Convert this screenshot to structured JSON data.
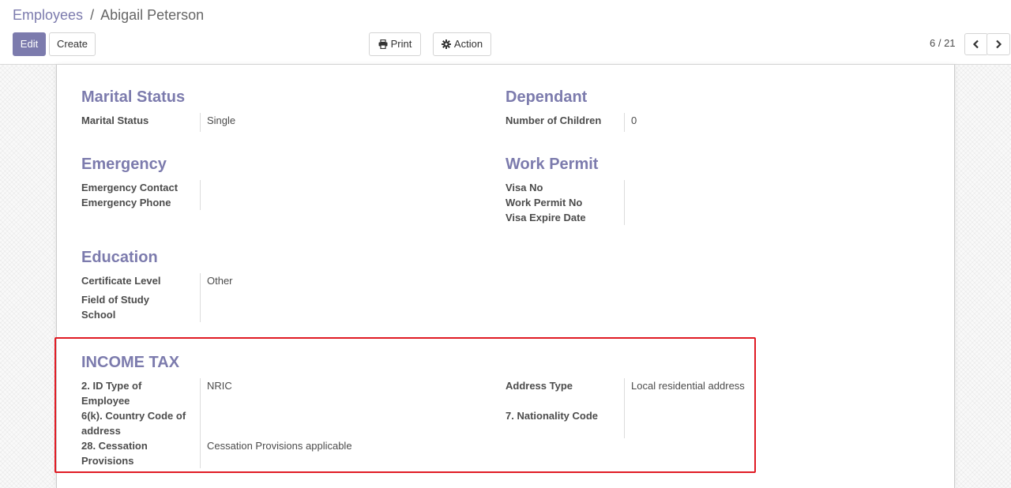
{
  "breadcrumb": {
    "parent": "Employees",
    "separator": "/",
    "current": "Abigail Peterson"
  },
  "toolbar": {
    "edit_label": "Edit",
    "create_label": "Create",
    "print_label": "Print",
    "action_label": "Action"
  },
  "pager": {
    "value": "6 / 21"
  },
  "sections": {
    "marital": {
      "title": "Marital Status",
      "fields": [
        {
          "label": "Marital Status",
          "value": "Single"
        }
      ]
    },
    "dependant": {
      "title": "Dependant",
      "fields": [
        {
          "label": "Number of Children",
          "value": "0"
        }
      ]
    },
    "emergency": {
      "title": "Emergency",
      "fields": [
        {
          "label": "Emergency Contact",
          "value": ""
        },
        {
          "label": "Emergency Phone",
          "value": ""
        }
      ]
    },
    "work_permit": {
      "title": "Work Permit",
      "fields": [
        {
          "label": "Visa No",
          "value": ""
        },
        {
          "label": "Work Permit No",
          "value": ""
        },
        {
          "label": "Visa Expire Date",
          "value": ""
        }
      ]
    },
    "education": {
      "title": "Education",
      "fields": [
        {
          "label": "Certificate Level",
          "value": "Other"
        },
        {
          "label": "Field of Study",
          "value": ""
        },
        {
          "label": "School",
          "value": ""
        }
      ]
    },
    "income_tax": {
      "title": "INCOME TAX",
      "left_fields": [
        {
          "label_line1": "2. ID Type of",
          "label_line2": "Employee",
          "value": "NRIC"
        },
        {
          "label_line1": "6(k). Country Code of",
          "label_line2": "address",
          "value": ""
        },
        {
          "label_line1": "28. Cessation",
          "label_line2": "Provisions",
          "value": "Cessation Provisions applicable"
        }
      ],
      "right_fields": [
        {
          "label": "Address Type",
          "value": "Local residential address"
        },
        {
          "label": "7. Nationality Code",
          "value": ""
        }
      ]
    }
  },
  "colors": {
    "brand": "#7c7bad",
    "highlight": "#e01b24"
  }
}
